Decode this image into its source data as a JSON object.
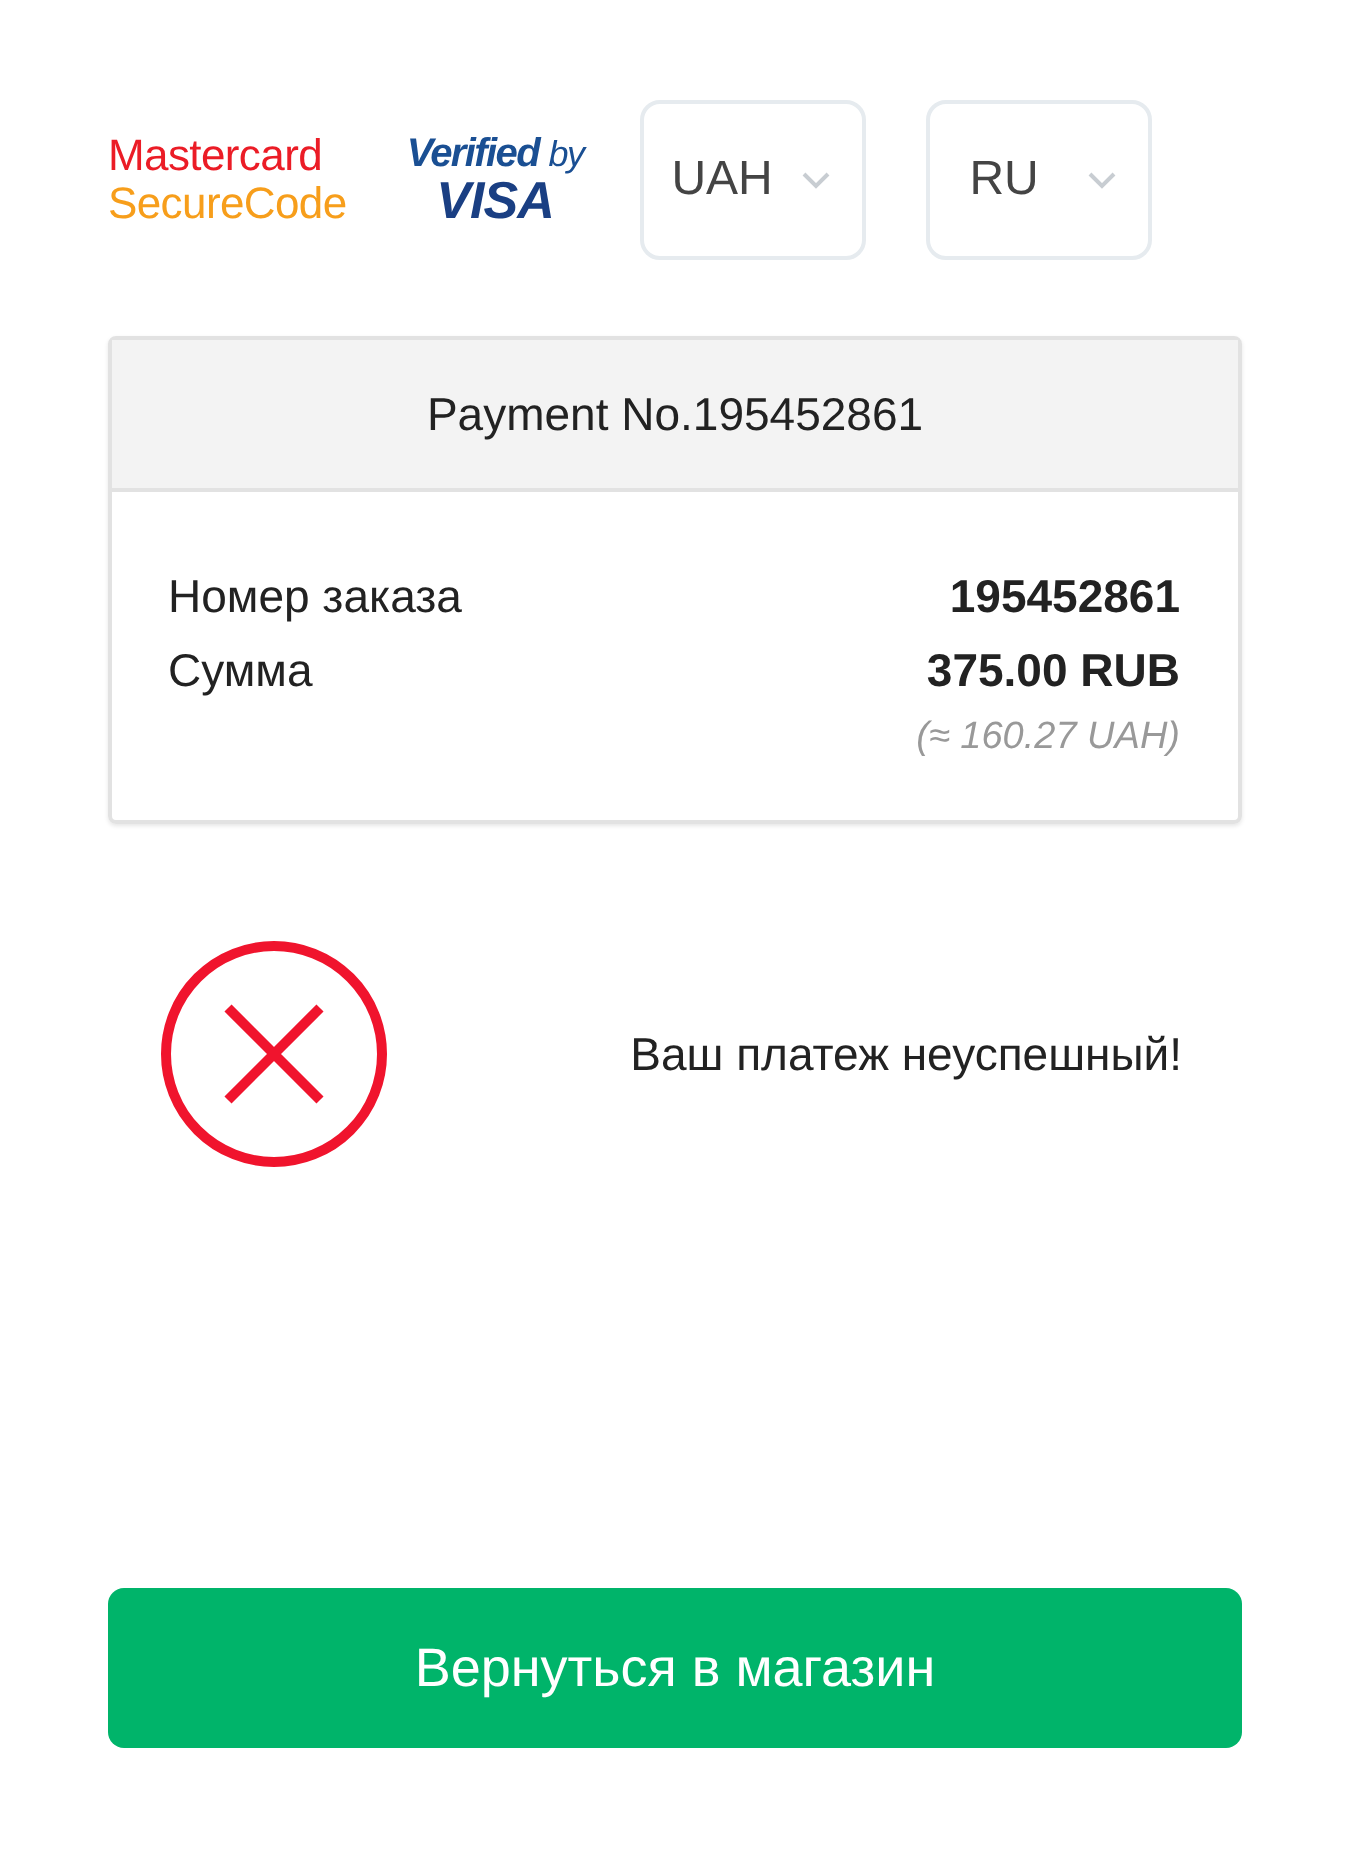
{
  "logos": {
    "mastercard": [
      "Mastercard",
      "SecureCode"
    ],
    "visa": {
      "top": "Verified",
      "by": "by",
      "brand": "VISA"
    }
  },
  "selects": [
    {
      "value": "UAH"
    },
    {
      "value": "RU"
    }
  ],
  "payment": {
    "title": "Payment No.195452861",
    "rows": [
      {
        "label": "Номер заказа",
        "value": "195452861"
      },
      {
        "label": "Сумма",
        "value": "375.00 RUB"
      }
    ],
    "converted": "(≈ 160.27 UAH)"
  },
  "status": {
    "kind": "error",
    "message": "Ваш платеж неуспешный!"
  },
  "button": "Вернуться в магазин"
}
